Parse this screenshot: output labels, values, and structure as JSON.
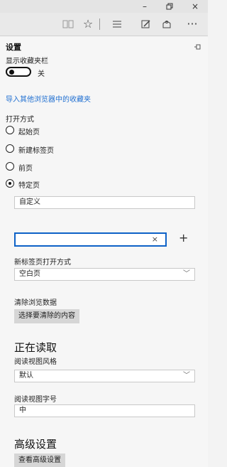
{
  "window": {
    "minimize": "–",
    "restore": "ⓤ",
    "close": "×"
  },
  "toolbar": {
    "reading_view_icon": "book-icon",
    "favorite_icon": "star-icon",
    "hub_icon": "hub-icon",
    "note_icon": "web-note-icon",
    "share_icon": "share-icon",
    "more_label": "···"
  },
  "settings": {
    "title": "设置",
    "favorites_bar": {
      "label": "显示收藏夹栏",
      "toggle_state": "关"
    },
    "import_link": "导入其他浏览器中的收藏夹",
    "open_with": {
      "label": "打开方式",
      "options": [
        "起始页",
        "新建标签页",
        "前页",
        "特定页"
      ],
      "selected_index": 3
    },
    "specific_page_select": "自定义",
    "url_input": {
      "value": "",
      "clear": "×",
      "add": "+"
    },
    "new_tab": {
      "label": "新标签页打开方式",
      "value": "空白页"
    },
    "clear_data": {
      "label": "清除浏览数据",
      "button": "选择要清除的内容"
    },
    "reading": {
      "heading": "正在读取",
      "style_label": "阅读视图风格",
      "style_value": "默认",
      "font_label": "阅读视图字号",
      "font_value": "中"
    },
    "advanced": {
      "heading": "高级设置",
      "button": "查看高级设置"
    }
  },
  "colors": {
    "accent": "#0e62c7",
    "link": "#1f6fd1"
  }
}
